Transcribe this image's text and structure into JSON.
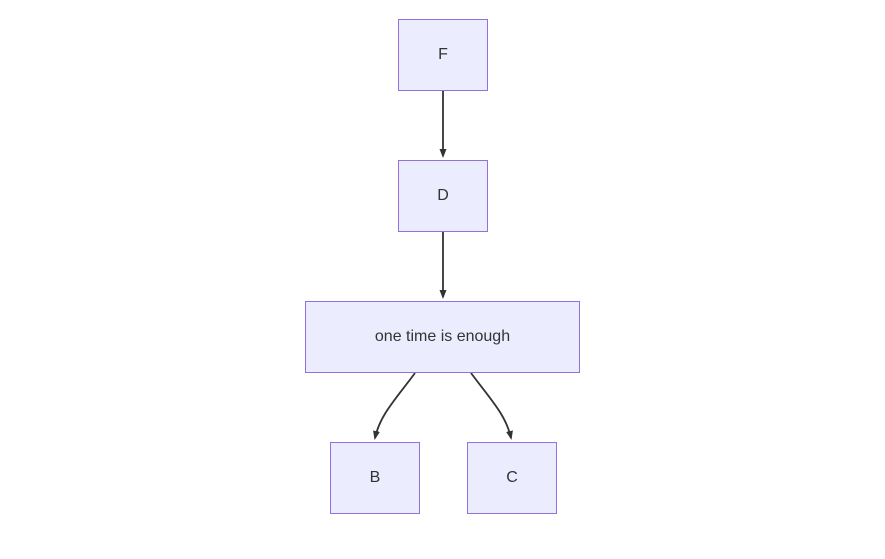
{
  "diagram": {
    "type": "flowchart",
    "direction": "top-down",
    "nodes": {
      "f": {
        "id": "F",
        "label": "F"
      },
      "d": {
        "id": "D",
        "label": "D"
      },
      "a": {
        "id": "A",
        "label": "one time is enough"
      },
      "b": {
        "id": "B",
        "label": "B"
      },
      "c": {
        "id": "C",
        "label": "C"
      }
    },
    "edges": [
      {
        "from": "F",
        "to": "D"
      },
      {
        "from": "D",
        "to": "A"
      },
      {
        "from": "A",
        "to": "B"
      },
      {
        "from": "A",
        "to": "C"
      }
    ],
    "colors": {
      "node_fill": "#ECECFF",
      "node_stroke": "#9370DB",
      "arrow": "#333333",
      "text": "#333333"
    }
  }
}
